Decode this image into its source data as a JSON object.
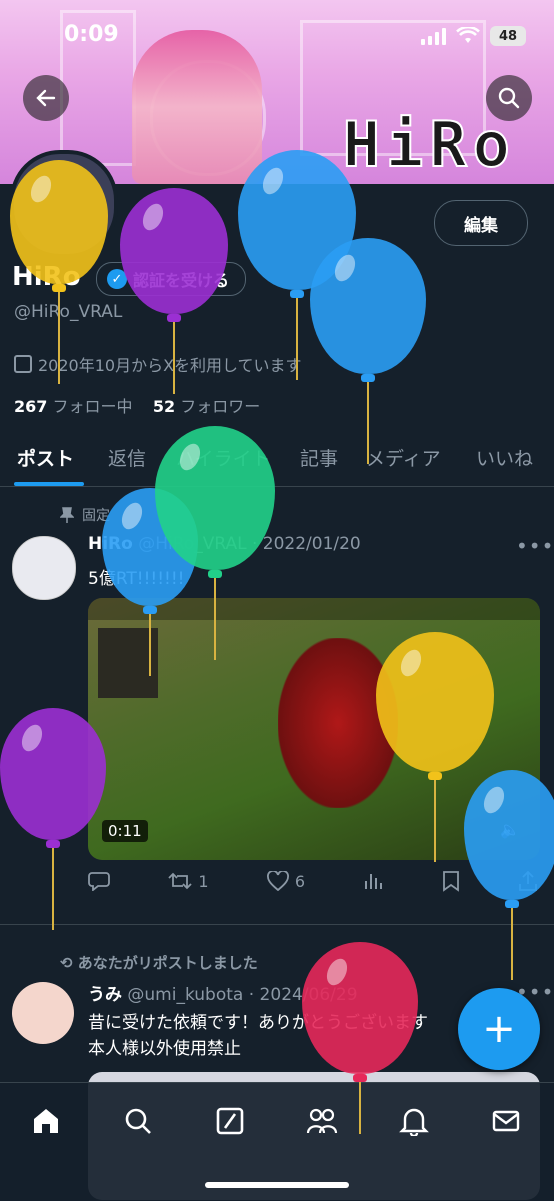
{
  "status_bar": {
    "time": "0:09",
    "battery": "48"
  },
  "banner": {
    "logo_text": "HiRo"
  },
  "profile": {
    "edit_label": "編集",
    "display_name": "HiRo",
    "verify_label": "認証を受ける",
    "handle": "@HiRo_VRAL",
    "joined": "2020年10月からXを利用しています",
    "following_count": "267",
    "following_label": "フォロー中",
    "followers_count": "52",
    "followers_label": "フォロワー"
  },
  "tabs": [
    {
      "label": "ポスト"
    },
    {
      "label": "返信"
    },
    {
      "label": "ハイライト"
    },
    {
      "label": "記事"
    },
    {
      "label": "メディア"
    },
    {
      "label": "いいね"
    }
  ],
  "post1": {
    "pinned_label": "固定",
    "name": "HiRo",
    "handle": "@HiRo_VRAL",
    "date": "· 2022/01/20",
    "text": "5億RT!!!!!!!",
    "video_duration": "0:11",
    "reposts": "1",
    "likes": "6"
  },
  "post2": {
    "reposted_label": "あなたがリポストしました",
    "name": "うみ",
    "handle": "@umi_kubota",
    "date": "· 2024/06/29",
    "text_line1": "昔に受けた依頼です！ありがとうございます",
    "text_line2": "本人様以外使用禁止"
  },
  "fab": {
    "label": "+"
  },
  "icons": {
    "back": "arrow-left-icon",
    "search": "search-icon",
    "calendar": "calendar-icon",
    "pin": "pin-icon",
    "reply": "reply-icon",
    "repost": "repost-icon",
    "like": "heart-icon",
    "views": "views-icon",
    "bookmark": "bookmark-icon",
    "share": "share-icon",
    "home": "home-icon",
    "explore": "search-icon",
    "grok": "grok-icon",
    "communities": "people-icon",
    "notifications": "bell-icon",
    "messages": "mail-icon"
  },
  "colors": {
    "accent": "#1d9bf0",
    "background": "#15202b",
    "muted": "#8b98a5"
  }
}
